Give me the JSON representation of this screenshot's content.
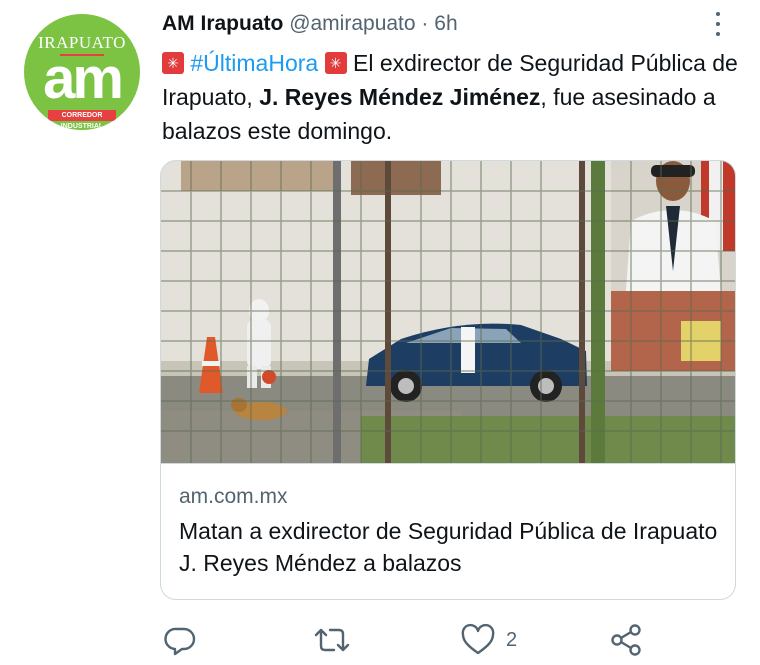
{
  "account": {
    "avatar_logo_top": "IRAPUATO",
    "avatar_logo_main": "am",
    "avatar_logo_tag": "CORREDOR INDUSTRIAL",
    "display_name": "AM Irapuato",
    "handle": "@amirapuato",
    "separator": "·",
    "time": "6h"
  },
  "tweet": {
    "hashtag": "#ÚltimaHora",
    "text_1": "El exdirector de Seguridad Pública de Irapuato, ",
    "bold_name": "J. Reyes Méndez Jiménez",
    "text_2": ", fue asesinado a balazos este domingo.",
    "emoji": "rotating-light-icon"
  },
  "card": {
    "domain": "am.com.mx",
    "title": "Matan a exdirector de Seguridad Pública de Irapuato J. Reyes Méndez a balazos"
  },
  "actions": {
    "reply_count": "",
    "retweet_count": "",
    "like_count": "2",
    "icons": [
      "reply-icon",
      "retweet-icon",
      "like-icon",
      "share-icon"
    ]
  },
  "colors": {
    "link": "#1d9bf0",
    "muted": "#536471",
    "avatar_green": "#7cc243",
    "avatar_red": "#e64040"
  }
}
